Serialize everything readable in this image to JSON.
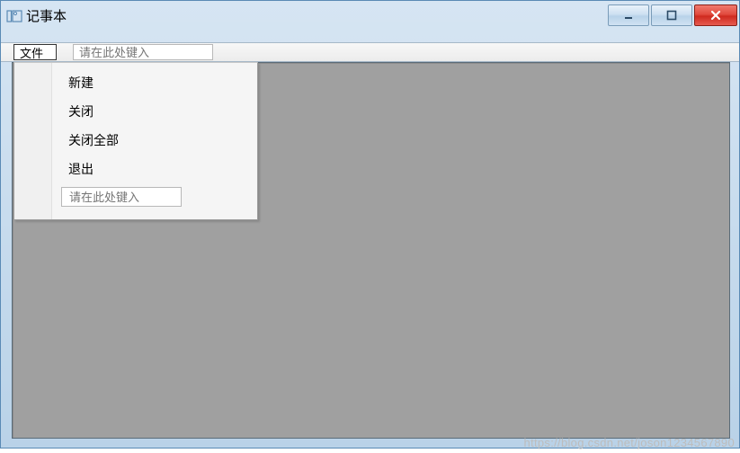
{
  "window": {
    "title": "记事本"
  },
  "menubar": {
    "file_label": "文件",
    "search_placeholder": "请在此处键入"
  },
  "dropdown": {
    "items": [
      {
        "label": "新建"
      },
      {
        "label": "关闭"
      },
      {
        "label": "关闭全部"
      },
      {
        "label": "退出"
      }
    ],
    "input_placeholder": "请在此处键入"
  },
  "watermark": "https://blog.csdn.net/joson1234567890"
}
